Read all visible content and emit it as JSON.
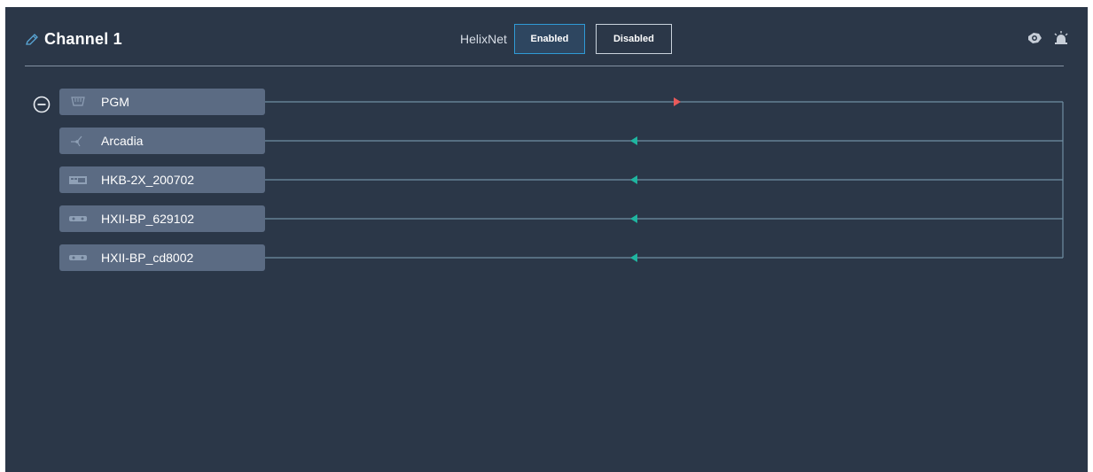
{
  "header": {
    "title": "Channel 1",
    "helixnet_label": "HelixNet",
    "enabled_label": "Enabled",
    "disabled_label": "Disabled",
    "icons": [
      "pencil-icon",
      "speaker-icon",
      "beacon-icon"
    ]
  },
  "devices": [
    {
      "label": "PGM",
      "icon": "program-input-icon",
      "direction": "talk",
      "arrow_color": "#e85a5a"
    },
    {
      "label": "Arcadia",
      "icon": "network-device-icon",
      "direction": "listen",
      "arrow_color": "#1fb5a0"
    },
    {
      "label": "HKB-2X_200702",
      "icon": "keypanel-icon",
      "direction": "listen",
      "arrow_color": "#1fb5a0"
    },
    {
      "label": "HXII-BP_629102",
      "icon": "beltpack-icon",
      "direction": "listen",
      "arrow_color": "#1fb5a0"
    },
    {
      "label": "HXII-BP_cd8002",
      "icon": "beltpack-icon",
      "direction": "listen",
      "arrow_color": "#1fb5a0"
    }
  ],
  "colors": {
    "background": "#2b3748",
    "row": "#5b6b83",
    "accent": "#2f9ad6"
  }
}
